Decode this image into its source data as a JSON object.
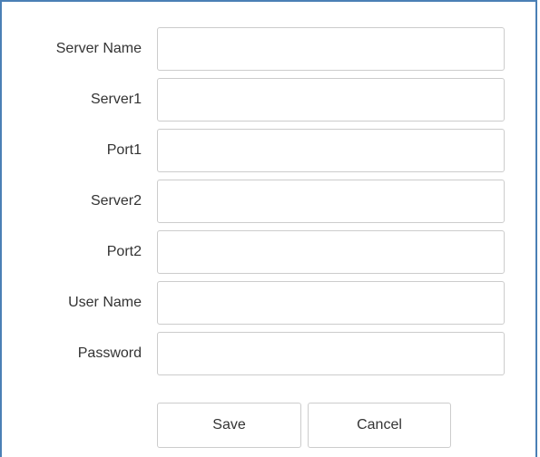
{
  "form": {
    "fields": [
      {
        "label": "Server Name",
        "value": ""
      },
      {
        "label": "Server1",
        "value": ""
      },
      {
        "label": "Port1",
        "value": ""
      },
      {
        "label": "Server2",
        "value": ""
      },
      {
        "label": "Port2",
        "value": ""
      },
      {
        "label": "User Name",
        "value": ""
      },
      {
        "label": "Password",
        "value": ""
      }
    ]
  },
  "buttons": {
    "save_label": "Save",
    "cancel_label": "Cancel"
  },
  "colors": {
    "panel_border": "#4a7fb5",
    "input_border": "#cccccc",
    "text": "#333333"
  }
}
